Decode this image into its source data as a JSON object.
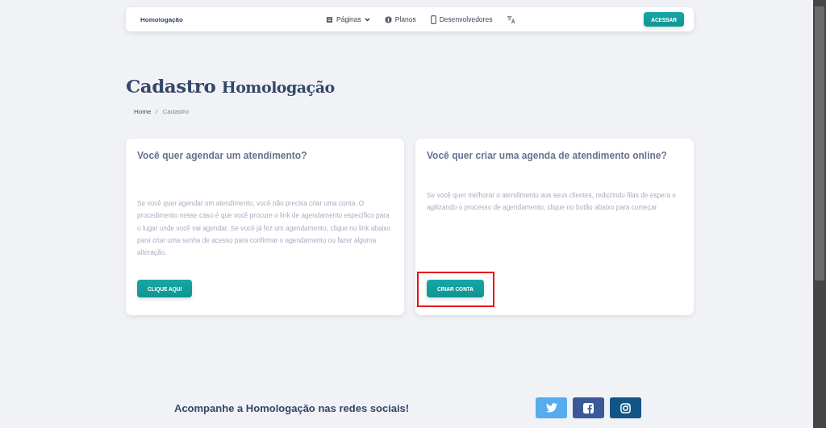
{
  "navbar": {
    "brand": "Homologação",
    "links": [
      {
        "kind": "pages",
        "label": "Páginas",
        "dropdown": true
      },
      {
        "kind": "coin",
        "label": "Planos",
        "dropdown": false
      },
      {
        "kind": "phone",
        "label": "Desenvolvedores",
        "dropdown": false
      },
      {
        "kind": "translate",
        "dropdown": false
      }
    ],
    "button": "ACESSAR"
  },
  "page_title": {
    "first": "Cadastro",
    "second": "Homologação"
  },
  "breadcrumb": {
    "separator": "/",
    "items": [
      "Home",
      "Cadastro"
    ]
  },
  "cards": [
    {
      "title": "Você quer agendar um atendimento?",
      "text": "Se você quer agendar um atendimento, você não precisa criar uma conta. O procedimento nesse caso é que você procure o link de agendamento específico para o lugar onde você vai agendar. Se você já fez um agendamento, clique no link abaixo para criar uma senha de acesso para confirmar o agendamento ou fazer alguma alteração.",
      "button": "CLIQUE AQUI",
      "highlighted": false
    },
    {
      "title": "Você quer criar uma agenda de atendimento online?",
      "text": "Se você quer melhorar o atendimento aos seus clientes, reduzindo filas de espera e agilizando o processo de agendamento, clique no botão abaixo para começar",
      "button": "CRIAR CONTA",
      "highlighted": true
    }
  ],
  "footer": {
    "text": "Acompanhe a Homologação nas redes sociais!",
    "social": [
      {
        "kind": "twitter",
        "color": "#55acee"
      },
      {
        "kind": "facebook",
        "color": "#3b5998"
      },
      {
        "kind": "instagram",
        "color": "#125688"
      }
    ]
  }
}
